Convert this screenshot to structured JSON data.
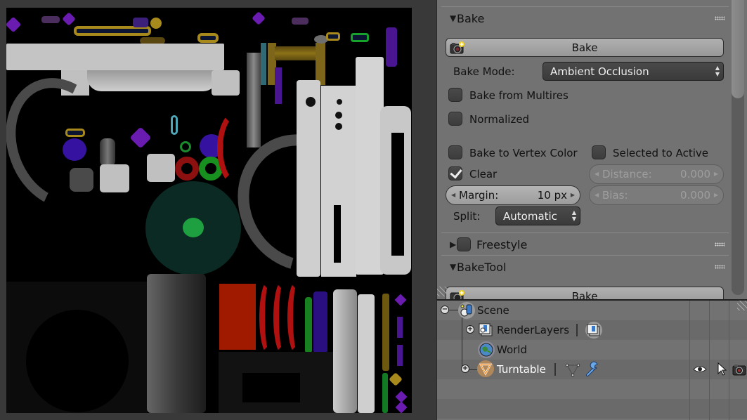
{
  "image_editor": {
    "description": "UV baked ambient occlusion texture"
  },
  "properties": {
    "bake_panel": {
      "title": "Bake",
      "expanded": true,
      "bake_button_label": "Bake",
      "bake_mode_label": "Bake Mode:",
      "bake_mode_value": "Ambient Occlusion",
      "bake_from_multires": {
        "label": "Bake from Multires",
        "checked": false
      },
      "normalized": {
        "label": "Normalized",
        "checked": false
      },
      "bake_to_vertex_color": {
        "label": "Bake to Vertex Color",
        "checked": false
      },
      "selected_to_active": {
        "label": "Selected to Active",
        "checked": false
      },
      "clear": {
        "label": "Clear",
        "checked": true
      },
      "margin": {
        "label": "Margin:",
        "value": "10 px"
      },
      "distance": {
        "label": "Distance:",
        "value": "0.000",
        "enabled": false
      },
      "bias": {
        "label": "Bias:",
        "value": "0.000",
        "enabled": false
      },
      "split_label": "Split:",
      "split_value": "Automatic"
    },
    "freestyle_panel": {
      "title": "Freestyle",
      "expanded": false,
      "enabled": false
    },
    "baketool_panel": {
      "title": "BakeTool",
      "expanded": true,
      "bake_button_label": "Bake"
    }
  },
  "outliner": {
    "items": [
      {
        "label": "Scene",
        "icon": "scene-icon",
        "expanded": true
      },
      {
        "label": "RenderLayers",
        "icon": "render-layers-icon",
        "expanded": false
      },
      {
        "label": "World",
        "icon": "world-icon"
      },
      {
        "label": "Turntable",
        "icon": "mesh-object-icon",
        "expanded": false,
        "active": true
      }
    ],
    "restrict_columns": [
      "visibility-eye-icon",
      "selectability-cursor-icon",
      "renderability-camera-icon"
    ]
  }
}
